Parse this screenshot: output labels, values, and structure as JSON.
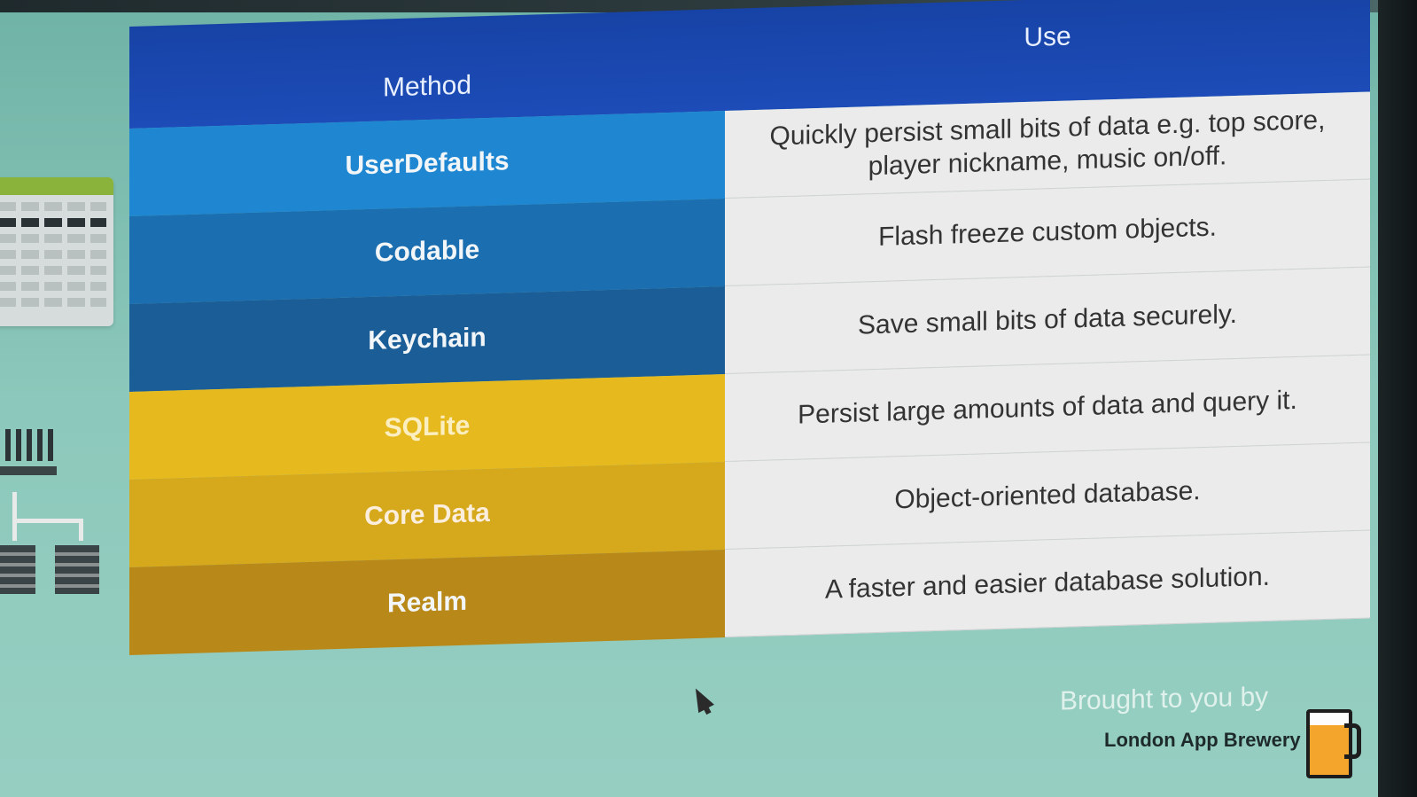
{
  "table": {
    "header": {
      "method": "Method",
      "use": "Use"
    },
    "rows": [
      {
        "method": "UserDefaults",
        "use_line1": "Quickly persist small bits of data e.g. top score,",
        "use_line2": "player nickname, music on/off."
      },
      {
        "method": "Codable",
        "use_line1": "Flash freeze custom objects.",
        "use_line2": ""
      },
      {
        "method": "Keychain",
        "use_line1": "Save small bits of data securely.",
        "use_line2": ""
      },
      {
        "method": "SQLite",
        "use_line1": "Persist large amounts of data and query it.",
        "use_line2": ""
      },
      {
        "method": "Core Data",
        "use_line1": "Object-oriented database.",
        "use_line2": ""
      },
      {
        "method": "Realm",
        "use_line1": "A faster and easier database solution.",
        "use_line2": ""
      }
    ]
  },
  "footer": {
    "brought_by": "Brought to you by",
    "brand": "London App Brewery"
  },
  "colors": {
    "header": "#1d4cb8",
    "userdefaults": "#1f87d2",
    "codable": "#1b6fb0",
    "keychain": "#1b5d96",
    "sqlite": "#e6ba1f",
    "coredata": "#d6a81c",
    "realm": "#b88818",
    "background": "#8cc8bb"
  },
  "icons": {
    "spreadsheet": "spreadsheet-illustration",
    "server": "server-illustration",
    "network": "network-tree-illustration",
    "logo": "beer-mug-logo",
    "cursor": "mouse-pointer"
  }
}
